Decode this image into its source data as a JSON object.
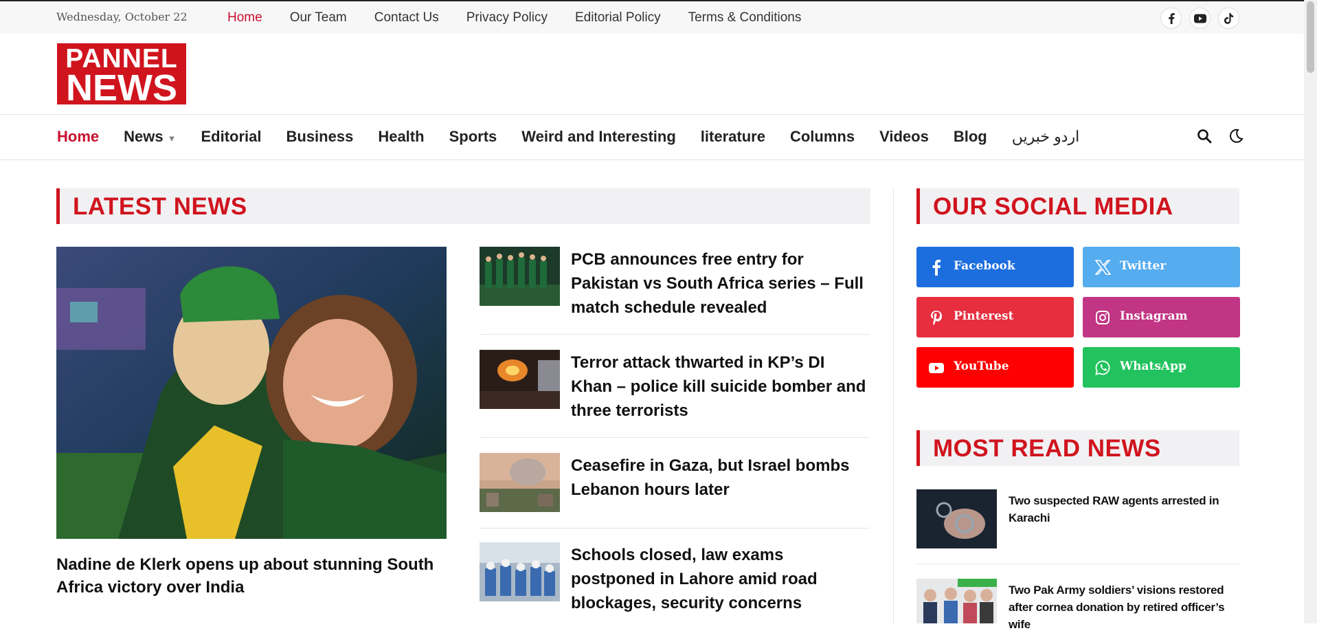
{
  "topbar": {
    "date": "Wednesday, October 22",
    "links": [
      {
        "label": "Home",
        "active": true
      },
      {
        "label": "Our Team"
      },
      {
        "label": "Contact Us"
      },
      {
        "label": "Privacy Policy"
      },
      {
        "label": "Editorial Policy"
      },
      {
        "label": "Terms & Conditions"
      }
    ],
    "social_icons": [
      "facebook-icon",
      "youtube-icon",
      "tiktok-icon"
    ]
  },
  "logo": {
    "line1": "PANNEL",
    "line2": "NEWS",
    "bg_color": "#d0141e"
  },
  "nav": {
    "items": [
      {
        "label": "Home",
        "active": true
      },
      {
        "label": "News",
        "has_dropdown": true
      },
      {
        "label": "Editorial"
      },
      {
        "label": "Business"
      },
      {
        "label": "Health"
      },
      {
        "label": "Sports"
      },
      {
        "label": "Weird and Interesting"
      },
      {
        "label": "literature"
      },
      {
        "label": "Columns"
      },
      {
        "label": "Videos"
      },
      {
        "label": "Blog"
      },
      {
        "label": "اردو خبریں"
      }
    ],
    "icons": [
      "search-icon",
      "dark-mode-moon-icon"
    ]
  },
  "latest": {
    "heading": "LATEST NEWS",
    "feature": {
      "title": "Nadine de Klerk opens up about stunning South Africa victory over India"
    },
    "stories": [
      {
        "title": "PCB announces free entry for Pakistan vs South Africa series – Full match schedule revealed"
      },
      {
        "title": "Terror attack thwarted in KP’s DI Khan – police kill suicide bomber and three terrorists"
      },
      {
        "title": "Ceasefire in Gaza, but Israel bombs Lebanon hours later"
      },
      {
        "title": "Schools closed, law exams postponed in Lahore amid road blockages, security concerns"
      }
    ]
  },
  "social": {
    "heading": "OUR SOCIAL MEDIA",
    "buttons": [
      {
        "label": "Facebook",
        "color": "#1c6ede",
        "icon": "facebook-icon"
      },
      {
        "label": "Twitter",
        "color": "#55acee",
        "icon": "x-twitter-icon"
      },
      {
        "label": "Pinterest",
        "color": "#e62e3e",
        "icon": "pinterest-icon"
      },
      {
        "label": "Instagram",
        "color": "#c13584",
        "icon": "instagram-icon"
      },
      {
        "label": "YouTube",
        "color": "#ff0000",
        "icon": "youtube-icon"
      },
      {
        "label": "WhatsApp",
        "color": "#22c35e",
        "icon": "whatsapp-icon"
      }
    ]
  },
  "most_read": {
    "heading": "MOST READ NEWS",
    "items": [
      {
        "title": "Two suspected RAW agents arrested in Karachi"
      },
      {
        "title": "Two Pak Army soldiers’ visions restored after cornea donation by retired officer’s wife"
      }
    ]
  },
  "colors": {
    "accent": "#d0141e",
    "active_link": "#c8102e"
  }
}
